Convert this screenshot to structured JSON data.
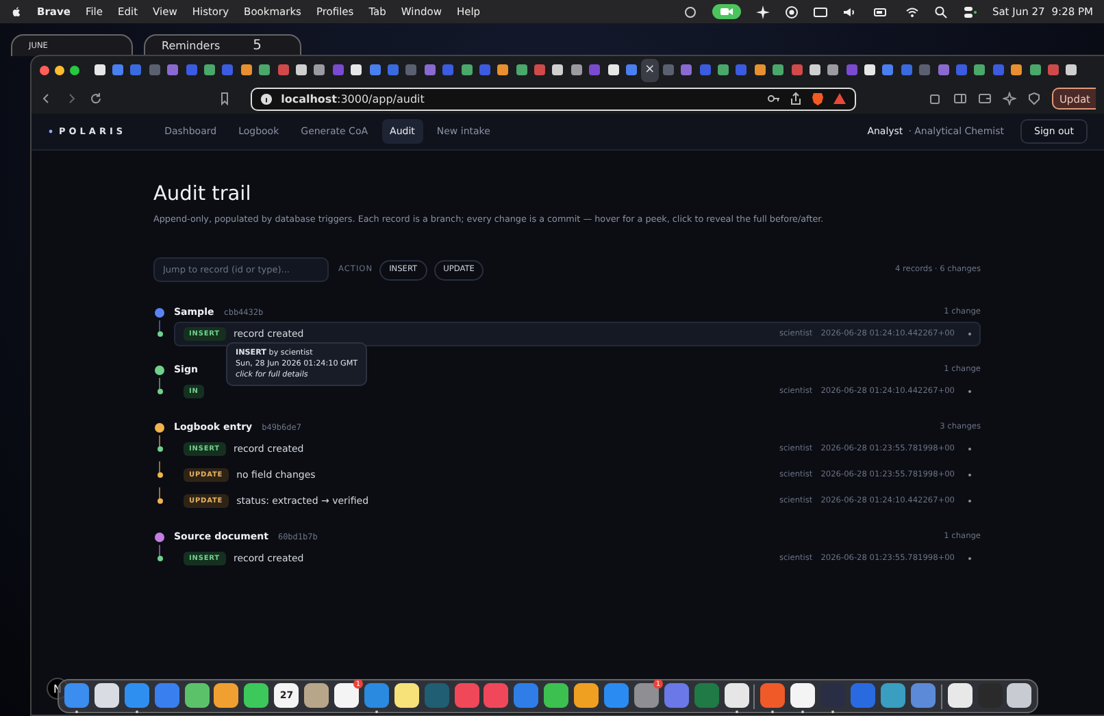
{
  "menubar": {
    "app": "Brave",
    "menus": [
      "File",
      "Edit",
      "View",
      "History",
      "Bookmarks",
      "Profiles",
      "Tab",
      "Window",
      "Help"
    ],
    "date": "Sat Jun 27",
    "time": "9:28 PM"
  },
  "widgets": {
    "calendar_month": "JUNE",
    "reminders_title": "Reminders",
    "reminders_count": "5"
  },
  "browser": {
    "tabs": [
      {
        "selected": false
      },
      {
        "selected": false
      },
      {
        "selected": false
      },
      {
        "selected": false
      },
      {
        "selected": false
      },
      {
        "selected": false
      },
      {
        "selected": false
      },
      {
        "selected": false
      },
      {
        "selected": false
      },
      {
        "selected": false
      },
      {
        "selected": false
      },
      {
        "selected": false
      },
      {
        "selected": false
      },
      {
        "selected": false
      },
      {
        "selected": false
      },
      {
        "selected": false
      },
      {
        "selected": false
      },
      {
        "selected": false
      },
      {
        "selected": false
      },
      {
        "selected": false
      },
      {
        "selected": false
      },
      {
        "selected": false
      },
      {
        "selected": false
      },
      {
        "selected": false
      },
      {
        "selected": false
      },
      {
        "selected": false
      },
      {
        "selected": false
      },
      {
        "selected": false
      },
      {
        "selected": false
      },
      {
        "selected": false
      },
      {
        "selected": true,
        "close": "×"
      },
      {
        "selected": false
      },
      {
        "selected": false
      },
      {
        "selected": false
      },
      {
        "selected": false
      },
      {
        "selected": false
      },
      {
        "selected": false
      },
      {
        "selected": false
      },
      {
        "selected": false
      },
      {
        "selected": false
      },
      {
        "selected": false
      },
      {
        "selected": false
      },
      {
        "selected": false
      },
      {
        "selected": false
      },
      {
        "selected": false
      },
      {
        "selected": false
      },
      {
        "selected": false
      },
      {
        "selected": false
      },
      {
        "selected": false
      },
      {
        "selected": false
      },
      {
        "selected": false
      },
      {
        "selected": false
      },
      {
        "selected": false
      },
      {
        "selected": false
      }
    ],
    "url": "**localhost**:3000/app/audit",
    "update_button": "Updat"
  },
  "app": {
    "brand": "POLARIS",
    "nav": [
      {
        "label": "Dashboard",
        "selected": false
      },
      {
        "label": "Logbook",
        "selected": false
      },
      {
        "label": "Generate CoA",
        "selected": false
      },
      {
        "label": "Audit",
        "selected": true
      },
      {
        "label": "New intake",
        "selected": false
      }
    ],
    "user_role": "Analyst",
    "user_title": "· Analytical Chemist",
    "sign_out": "Sign out"
  },
  "page": {
    "title": "Audit trail",
    "subtitle": "Append-only, populated by database triggers. Each record is a branch; every change is a commit — hover for a peek, click to reveal the full before/after.",
    "search": {
      "placeholder": "Jump to record (id or type)..."
    },
    "action_label": "ACTION",
    "filters": [
      {
        "label": "INSERT",
        "selected": false
      },
      {
        "label": "UPDATE",
        "selected": false
      }
    ],
    "summary": "4 records · 6 changes"
  },
  "groups": [
    {
      "name": "Sample",
      "id": "cbb4432b",
      "count": "1 change",
      "color": "#5b82f5",
      "events": [
        {
          "action": "INSERT",
          "kind": "insert",
          "text": "record created",
          "actor": "scientist",
          "time": "2026-06-28 01:24:10.442267+00",
          "hovered": true
        }
      ]
    },
    {
      "name": "Sign",
      "count": "1 change",
      "color": "#6fd08c",
      "events": [
        {
          "action": "IN",
          "kind": "insert",
          "actor": "scientist",
          "time": "2026-06-28 01:24:10.442267+00",
          "hovered": false
        }
      ]
    },
    {
      "name": "Logbook entry",
      "id": "b49b6de7",
      "count": "3 changes",
      "color": "#f0b44c",
      "events": [
        {
          "action": "INSERT",
          "kind": "insert",
          "text": "record created",
          "actor": "scientist",
          "time": "2026-06-28 01:23:55.781998+00",
          "hovered": false
        },
        {
          "action": "UPDATE",
          "kind": "update",
          "text": "no field changes",
          "actor": "scientist",
          "time": "2026-06-28 01:23:55.781998+00",
          "hovered": false
        },
        {
          "action": "UPDATE",
          "kind": "update",
          "text": "status: extracted → verified",
          "actor": "scientist",
          "time": "2026-06-28 01:24:10.442267+00",
          "hovered": false
        }
      ]
    },
    {
      "name": "Source document",
      "id": "60bd1b7b",
      "count": "1 change",
      "color": "#c27ee0",
      "events": [
        {
          "action": "INSERT",
          "kind": "insert",
          "text": "record created",
          "actor": "scientist",
          "time": "2026-06-28 01:23:55.781998+00",
          "hovered": false
        }
      ]
    }
  ],
  "tooltip": {
    "heading": "**INSERT** by scientist",
    "date": "Sun, 28 Jun 2026 01:24:10 GMT",
    "hint": "click for full details"
  },
  "dev_indicator": "N",
  "dock": [
    {
      "color": "#3b8df0",
      "running": true
    },
    {
      "color": "#d9dce3",
      "running": false
    },
    {
      "color": "#2f8ff0",
      "running": true
    },
    {
      "color": "#3a7ff0",
      "running": false
    },
    {
      "color": "#5cc26a",
      "running": false
    },
    {
      "color": "#f0a030",
      "running": false
    },
    {
      "color": "#3cc85a",
      "running": false
    },
    {
      "color": "#f4f4f4",
      "running": false,
      "label": "27"
    },
    {
      "color": "#b8a68a",
      "running": false
    },
    {
      "color": "#f4f4f4",
      "running": false,
      "badge": "1"
    },
    {
      "color": "#2a8ae0",
      "running": true
    },
    {
      "color": "#f7e27a",
      "running": false
    },
    {
      "color": "#1f5e73",
      "running": false
    },
    {
      "color": "#f04858",
      "running": false
    },
    {
      "color": "#f0485a",
      "running": false
    },
    {
      "color": "#2f7ee8",
      "running": false
    },
    {
      "color": "#3cc050",
      "running": false
    },
    {
      "color": "#f0a020",
      "running": false
    },
    {
      "color": "#2a8cf2",
      "running": false
    },
    {
      "color": "#8e8e93",
      "running": false,
      "badge": "1"
    },
    {
      "color": "#6a78e8",
      "running": false
    },
    {
      "color": "#1f7a45",
      "running": false
    },
    {
      "color": "#e6e6e6",
      "running": true
    },
    {
      "color": "#f05a28",
      "running": true
    },
    {
      "color": "#f4f4f4",
      "running": true
    },
    {
      "color": "#2a2e44",
      "running": true
    },
    {
      "color": "#2a6ae0",
      "running": false
    },
    {
      "color": "#3a9ec0",
      "running": false
    },
    {
      "color": "#5c8ad8",
      "running": false
    },
    {
      "color": "#e8e8e8",
      "running": false
    },
    {
      "color": "#2a2a2a",
      "running": false
    },
    {
      "color": "#c8ccd2",
      "running": false
    }
  ]
}
